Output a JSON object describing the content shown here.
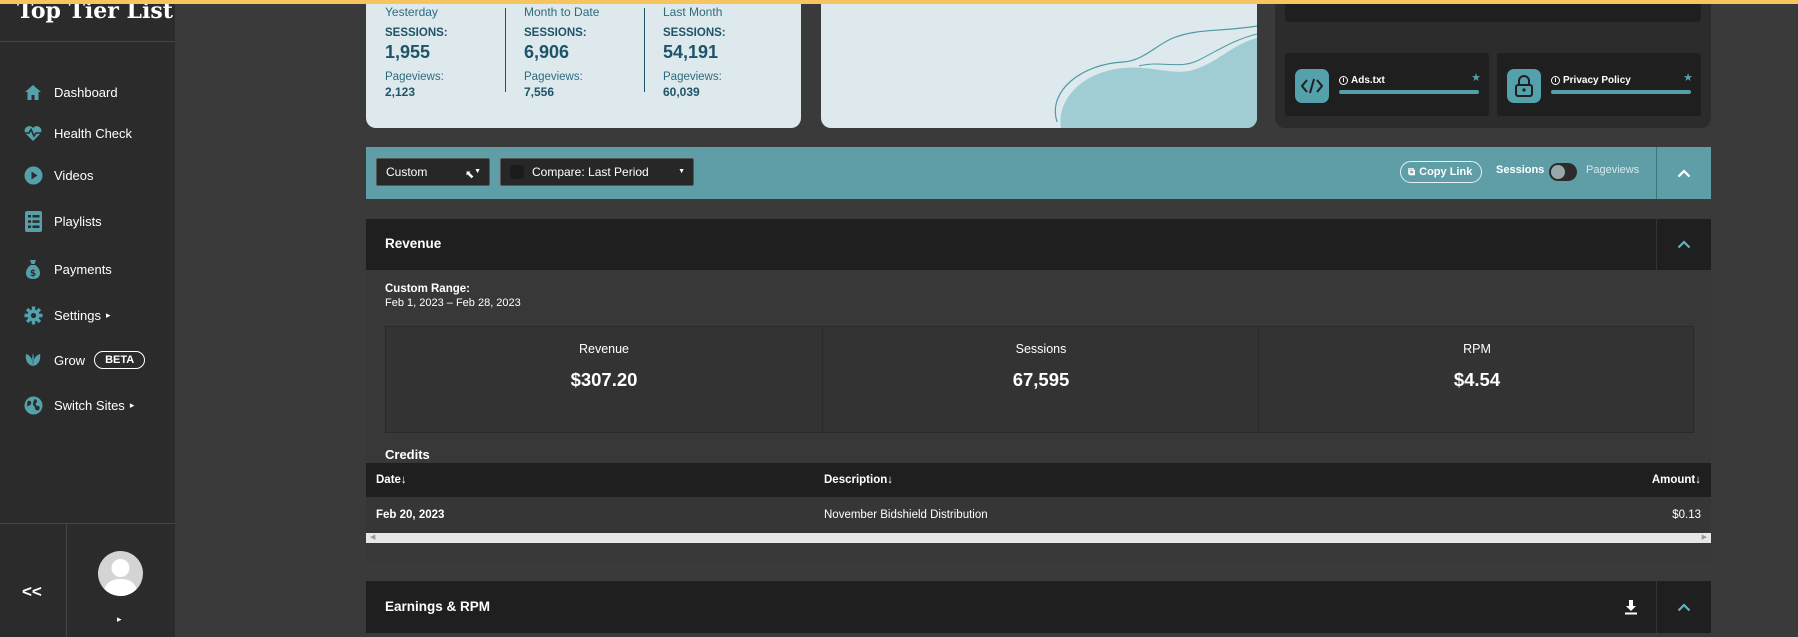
{
  "brand": "Top Tier List",
  "nav": [
    {
      "label": "Dashboard",
      "icon": "home-icon"
    },
    {
      "label": "Health Check",
      "icon": "heart-pulse-icon"
    },
    {
      "label": "Videos",
      "icon": "play-circle-icon"
    },
    {
      "label": "Playlists",
      "icon": "list-icon"
    },
    {
      "label": "Payments",
      "icon": "money-bag-icon"
    },
    {
      "label": "Settings",
      "icon": "gear-icon",
      "caret": "▸"
    },
    {
      "label": "Grow",
      "icon": "leaf-icon",
      "badge": "BETA"
    },
    {
      "label": "Switch Sites",
      "icon": "globe-icon",
      "caret": "▸"
    }
  ],
  "sidebar_footer": {
    "collapse": "<<",
    "caret": "▸"
  },
  "stats": [
    {
      "period": "Yesterday",
      "sessions_label": "SESSIONS:",
      "sessions": "1,955",
      "pageviews_label": "Pageviews:",
      "pageviews": "2,123"
    },
    {
      "period": "Month to Date",
      "sessions_label": "SESSIONS:",
      "sessions": "6,906",
      "pageviews_label": "Pageviews:",
      "pageviews": "7,556"
    },
    {
      "period": "Last Month",
      "sessions_label": "SESSIONS:",
      "sessions": "54,191",
      "pageviews_label": "Pageviews:",
      "pageviews": "60,039"
    }
  ],
  "tools": [
    {
      "label": "Ads.txt",
      "icon": "code-icon"
    },
    {
      "label": "Privacy Policy",
      "icon": "lock-icon"
    }
  ],
  "filters": {
    "range_select": "Custom",
    "compare_select": "Compare: Last Period",
    "copy_link": "Copy Link",
    "toggle_left": "Sessions",
    "toggle_right": "Pageviews"
  },
  "revenue": {
    "title": "Revenue",
    "range_label": "Custom Range:",
    "range_value": "Feb 1, 2023 – Feb 28, 2023",
    "metrics": [
      {
        "label": "Revenue",
        "value": "$307.20"
      },
      {
        "label": "Sessions",
        "value": "67,595"
      },
      {
        "label": "RPM",
        "value": "$4.54"
      }
    ],
    "credits_title": "Credits",
    "columns": {
      "date": "Date↓",
      "description": "Description↓",
      "amount": "Amount↓"
    },
    "rows": [
      {
        "date": "Feb 20, 2023",
        "description": "November Bidshield Distribution",
        "amount": "$0.13"
      }
    ]
  },
  "earnings": {
    "title": "Earnings & RPM"
  },
  "colors": {
    "accent": "#5f9ea7",
    "topbar": "#f6c55f",
    "card": "#dde9ec"
  }
}
